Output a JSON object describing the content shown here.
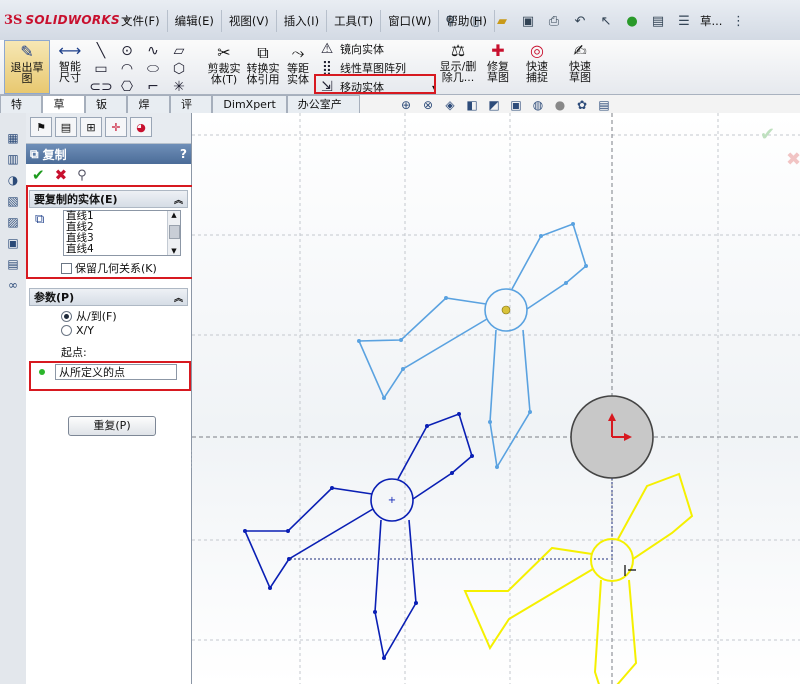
{
  "app": {
    "ds_mark": "3S",
    "name": "SOLIDWORKS"
  },
  "menu": [
    {
      "label": "文件(F)"
    },
    {
      "label": "编辑(E)"
    },
    {
      "label": "视图(V)"
    },
    {
      "label": "插入(I)"
    },
    {
      "label": "工具(T)"
    },
    {
      "label": "窗口(W)"
    },
    {
      "label": "帮助(H)"
    }
  ],
  "quick_toolbar": {
    "overflow_label": "草..."
  },
  "ribbon": {
    "exit_sketch": "退出草图",
    "smart_dimension": "智能尺寸",
    "trim_entities": "剪裁实体(T)",
    "convert_entities": "转换实体引用",
    "offset_entities": "等距实体",
    "mirror_entities": "镜向实体",
    "linear_pattern": "线性草图阵列",
    "move_entities": "移动实体",
    "display_delete_relations": "显示/删除几...",
    "repair_sketch": "修复草图",
    "quick_snaps": "快速捕捉",
    "rapid_sketch": "快速草图"
  },
  "tabs": [
    {
      "label": "特征"
    },
    {
      "label": "草图",
      "active": true
    },
    {
      "label": "钣金"
    },
    {
      "label": "焊件"
    },
    {
      "label": "评估"
    },
    {
      "label": "DimXpert"
    },
    {
      "label": "办公室产品"
    }
  ],
  "property_manager": {
    "title": "复制",
    "help": "?",
    "entities_group": {
      "title": "要复制的实体(E)",
      "items": [
        "直线1",
        "直线2",
        "直线3",
        "直线4"
      ],
      "keep_relations_label": "保留几何关系(K)",
      "keep_relations_checked": false
    },
    "params_group": {
      "title": "参数(P)",
      "option_from_to": "从/到(F)",
      "option_xy": "X/Y",
      "selected_option": "from_to",
      "start_point_label": "起点:",
      "start_point_value": "从所定义的点"
    },
    "repeat_button": "重复(P)"
  },
  "colors": {
    "accent_red": "#d71920",
    "light_blue_sketch": "#5aa2e0",
    "dark_blue_sketch": "#0a1fb4",
    "yellow_sketch": "#f5f000",
    "pm_header": "#5a7aa6"
  },
  "icons": {
    "confirm": "check-icon",
    "cancel": "close-icon",
    "pushpin": "pushpin-icon"
  }
}
